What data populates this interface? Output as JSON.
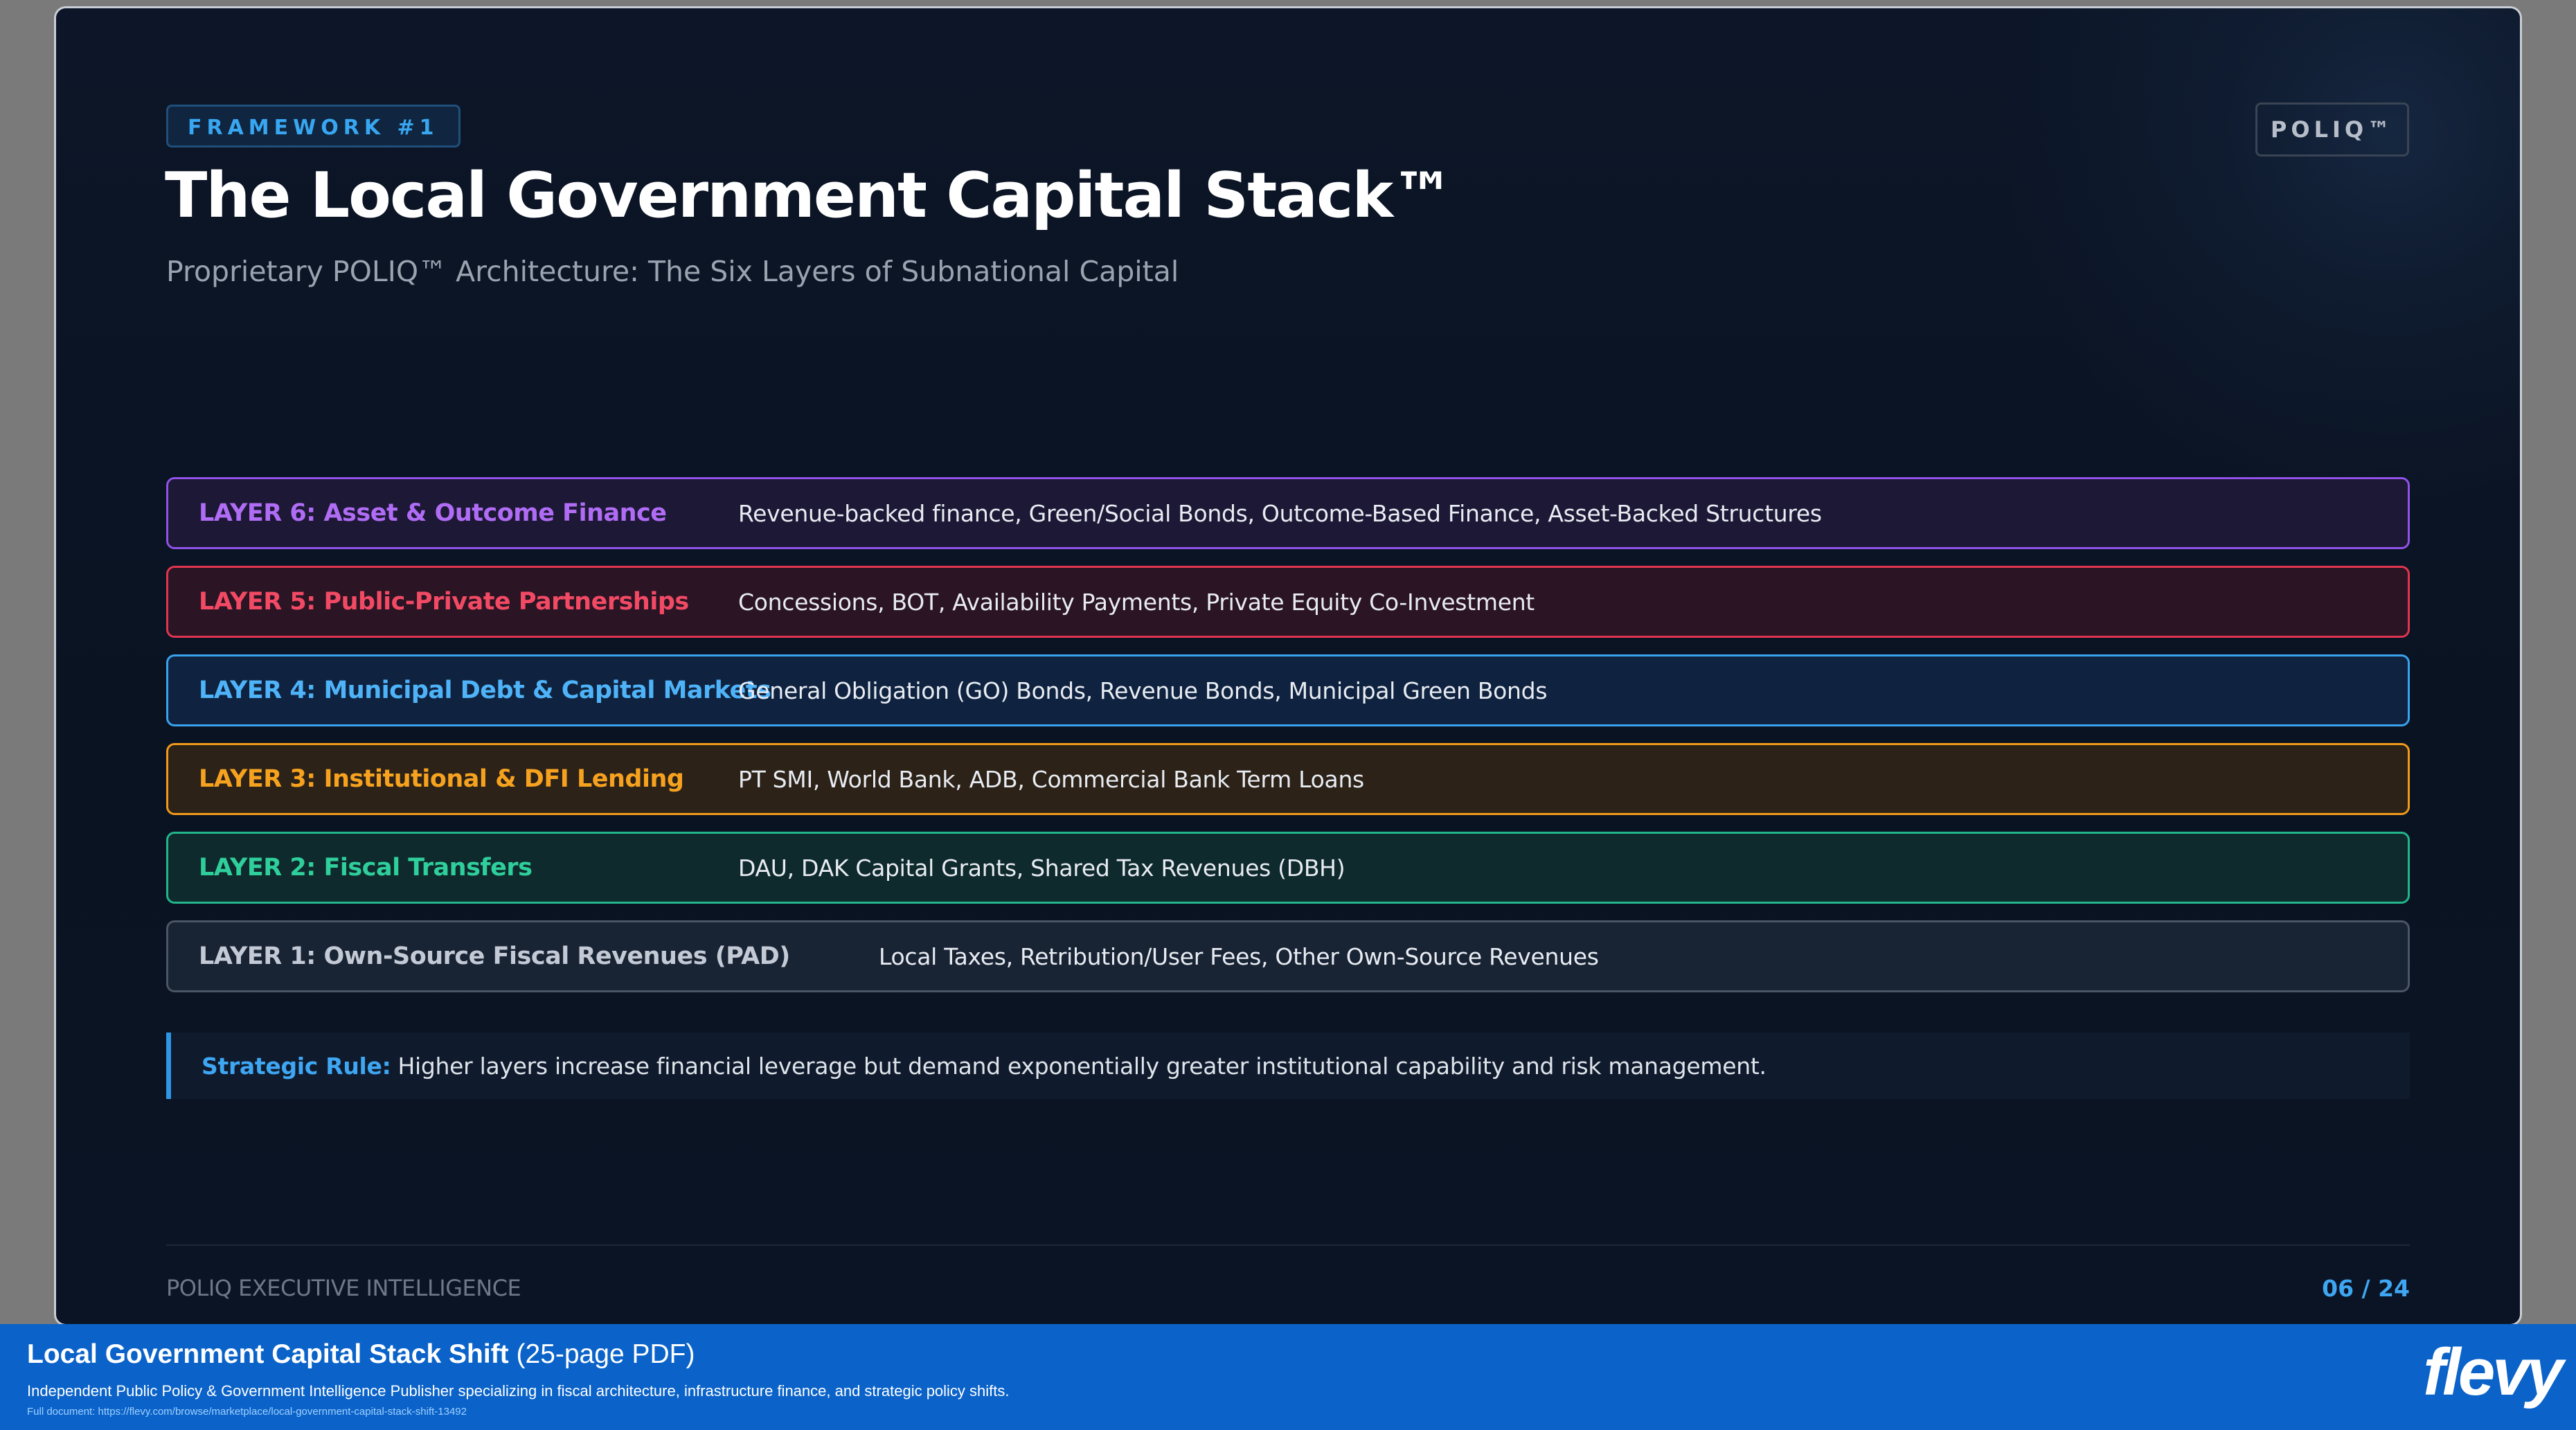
{
  "slide": {
    "tag": "FRAMEWORK #1",
    "brand": "POLIQ™",
    "title": "The Local Government Capital Stack™",
    "subtitle": "Proprietary POLIQ™ Architecture: The Six Layers of Subnational Capital",
    "layers": [
      {
        "name": "LAYER 6: Asset & Outcome Finance",
        "description": "Revenue-backed finance, Green/Social Bonds, Outcome-Based Finance, Asset-Backed Structures",
        "color": "#9152e8"
      },
      {
        "name": "LAYER 5: Public-Private Partnerships",
        "description": "Concessions, BOT, Availability Payments, Private Equity Co-Investment",
        "color": "#e0354f"
      },
      {
        "name": "LAYER 4: Municipal Debt & Capital Markets",
        "description": "General Obligation (GO) Bonds, Revenue Bonds, Municipal Green Bonds",
        "color": "#3aa2ee"
      },
      {
        "name": "LAYER 3: Institutional & DFI Lending",
        "description": "PT SMI, World Bank, ADB, Commercial Bank Term Loans",
        "color": "#f19a1a"
      },
      {
        "name": "LAYER 2: Fiscal Transfers",
        "description": "DAU, DAK Capital Grants, Shared Tax Revenues (DBH)",
        "color": "#22b68b"
      },
      {
        "name": "LAYER 1: Own-Source Fiscal Revenues (PAD)",
        "description": "Local Taxes, Retribution/User Fees, Other Own-Source Revenues",
        "color": "#4a5566"
      }
    ],
    "rule": {
      "label": "Strategic Rule:",
      "text": "Higher layers increase financial leverage but demand exponentially greater institutional capability and risk management."
    },
    "footer": {
      "left": "POLIQ EXECUTIVE INTELLIGENCE",
      "page": "06 / 24"
    }
  },
  "banner": {
    "title": "Local Government Capital Stack Shift",
    "title_suffix": "(25-page PDF)",
    "description": "Independent Public Policy & Government Intelligence Publisher specializing in fiscal architecture, infrastructure finance, and strategic policy shifts.",
    "link": "Full document: https://flevy.com/browse/marketplace/local-government-capital-stack-shift-13492",
    "logo": "flevy"
  }
}
